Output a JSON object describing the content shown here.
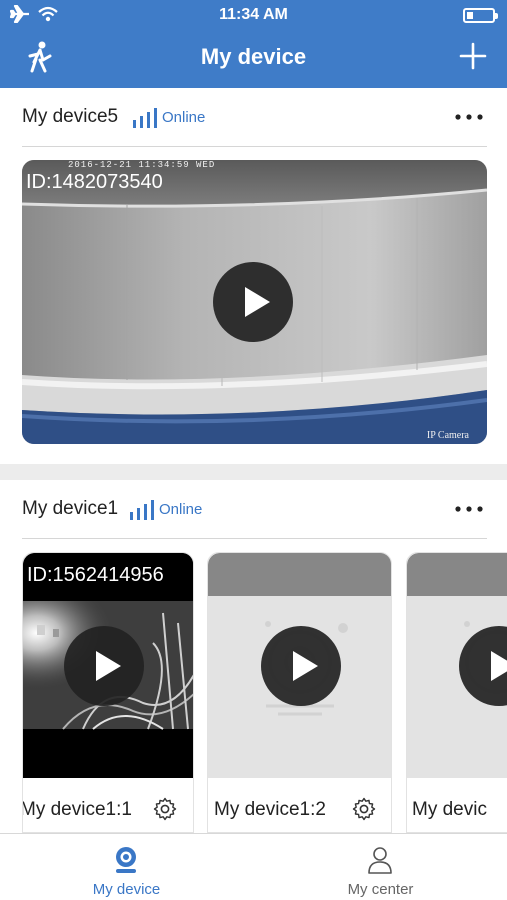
{
  "status_bar": {
    "time": "11:34 AM"
  },
  "nav": {
    "title": "My device"
  },
  "devices": [
    {
      "name": "My device5",
      "status": "Online",
      "cameras": [
        {
          "id": "ID:1482073540",
          "overlay_top": "2016-12-21 11:34:59 WED",
          "overlay_bottom": "IP Camera"
        }
      ]
    },
    {
      "name": "My device1",
      "status": "Online",
      "cameras": [
        {
          "id": "ID:1562414956",
          "label": "My device1:1"
        },
        {
          "label": "My device1:2"
        },
        {
          "label": "My devic"
        }
      ]
    }
  ],
  "tabs": [
    {
      "label": "My device",
      "active": true
    },
    {
      "label": "My center",
      "active": false
    }
  ],
  "colors": {
    "brand": "#3f7cc8",
    "tab_inactive": "#666666"
  }
}
